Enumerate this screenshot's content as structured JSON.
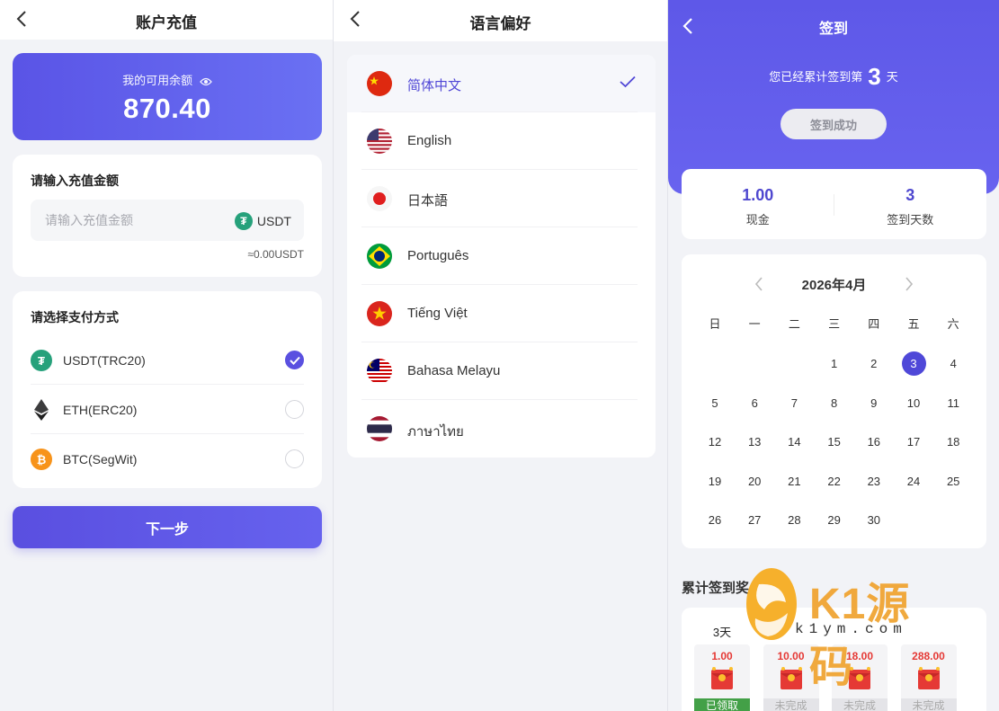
{
  "recharge": {
    "title": "账户充值",
    "balance_label": "我的可用余额",
    "balance": "870.40",
    "amount_title": "请输入充值金额",
    "amount_placeholder": "请输入充值金额",
    "currency": "USDT",
    "approx": "≈0.00USDT",
    "pay_title": "请选择支付方式",
    "methods": [
      {
        "name": "USDT(TRC20)",
        "icon": "tether-icon",
        "color": "#26a17b",
        "selected": true
      },
      {
        "name": "ETH(ERC20)",
        "icon": "ethereum-icon",
        "color": "#3c3c3d",
        "selected": false
      },
      {
        "name": "BTC(SegWit)",
        "icon": "bitcoin-icon",
        "color": "#f7931a",
        "selected": false
      }
    ],
    "next_label": "下一步"
  },
  "language": {
    "title": "语言偏好",
    "items": [
      {
        "label": "简体中文",
        "flag": "china-flag-icon",
        "selected": true
      },
      {
        "label": "English",
        "flag": "usa-flag-icon",
        "selected": false
      },
      {
        "label": "日本語",
        "flag": "japan-flag-icon",
        "selected": false
      },
      {
        "label": "Português",
        "flag": "brazil-flag-icon",
        "selected": false
      },
      {
        "label": "Tiếng Việt",
        "flag": "vietnam-flag-icon",
        "selected": false
      },
      {
        "label": "Bahasa Melayu",
        "flag": "malaysia-flag-icon",
        "selected": false
      },
      {
        "label": "ภาษาไทย",
        "flag": "thailand-flag-icon",
        "selected": false
      }
    ]
  },
  "checkin": {
    "title": "签到",
    "streak_prefix": "您已经累计签到第",
    "streak_days": "3",
    "streak_suffix": "天",
    "status_button": "签到成功",
    "cash_value": "1.00",
    "cash_label": "现金",
    "days_value": "3",
    "days_label": "签到天数",
    "month_label": "2026年4月",
    "weekdays": [
      "日",
      "一",
      "二",
      "三",
      "四",
      "五",
      "六"
    ],
    "today": 3,
    "rewards_title": "累计签到奖",
    "rewards": [
      {
        "days": "3天",
        "amount": "1.00",
        "status": "已领取",
        "done": true
      },
      {
        "days": "",
        "amount": "10.00",
        "status": "未完成",
        "done": false
      },
      {
        "days": "",
        "amount": "18.00",
        "status": "未完成",
        "done": false
      },
      {
        "days": "",
        "amount": "288.00",
        "status": "未完成",
        "done": false
      }
    ]
  },
  "watermark": {
    "logo_text": "K1源码",
    "url": "k1ym.com"
  },
  "colors": {
    "primary": "#5a50e0",
    "hero": "#6460ec",
    "today": "#4f48d8",
    "tether": "#26a17b",
    "reward": "#e53935"
  }
}
